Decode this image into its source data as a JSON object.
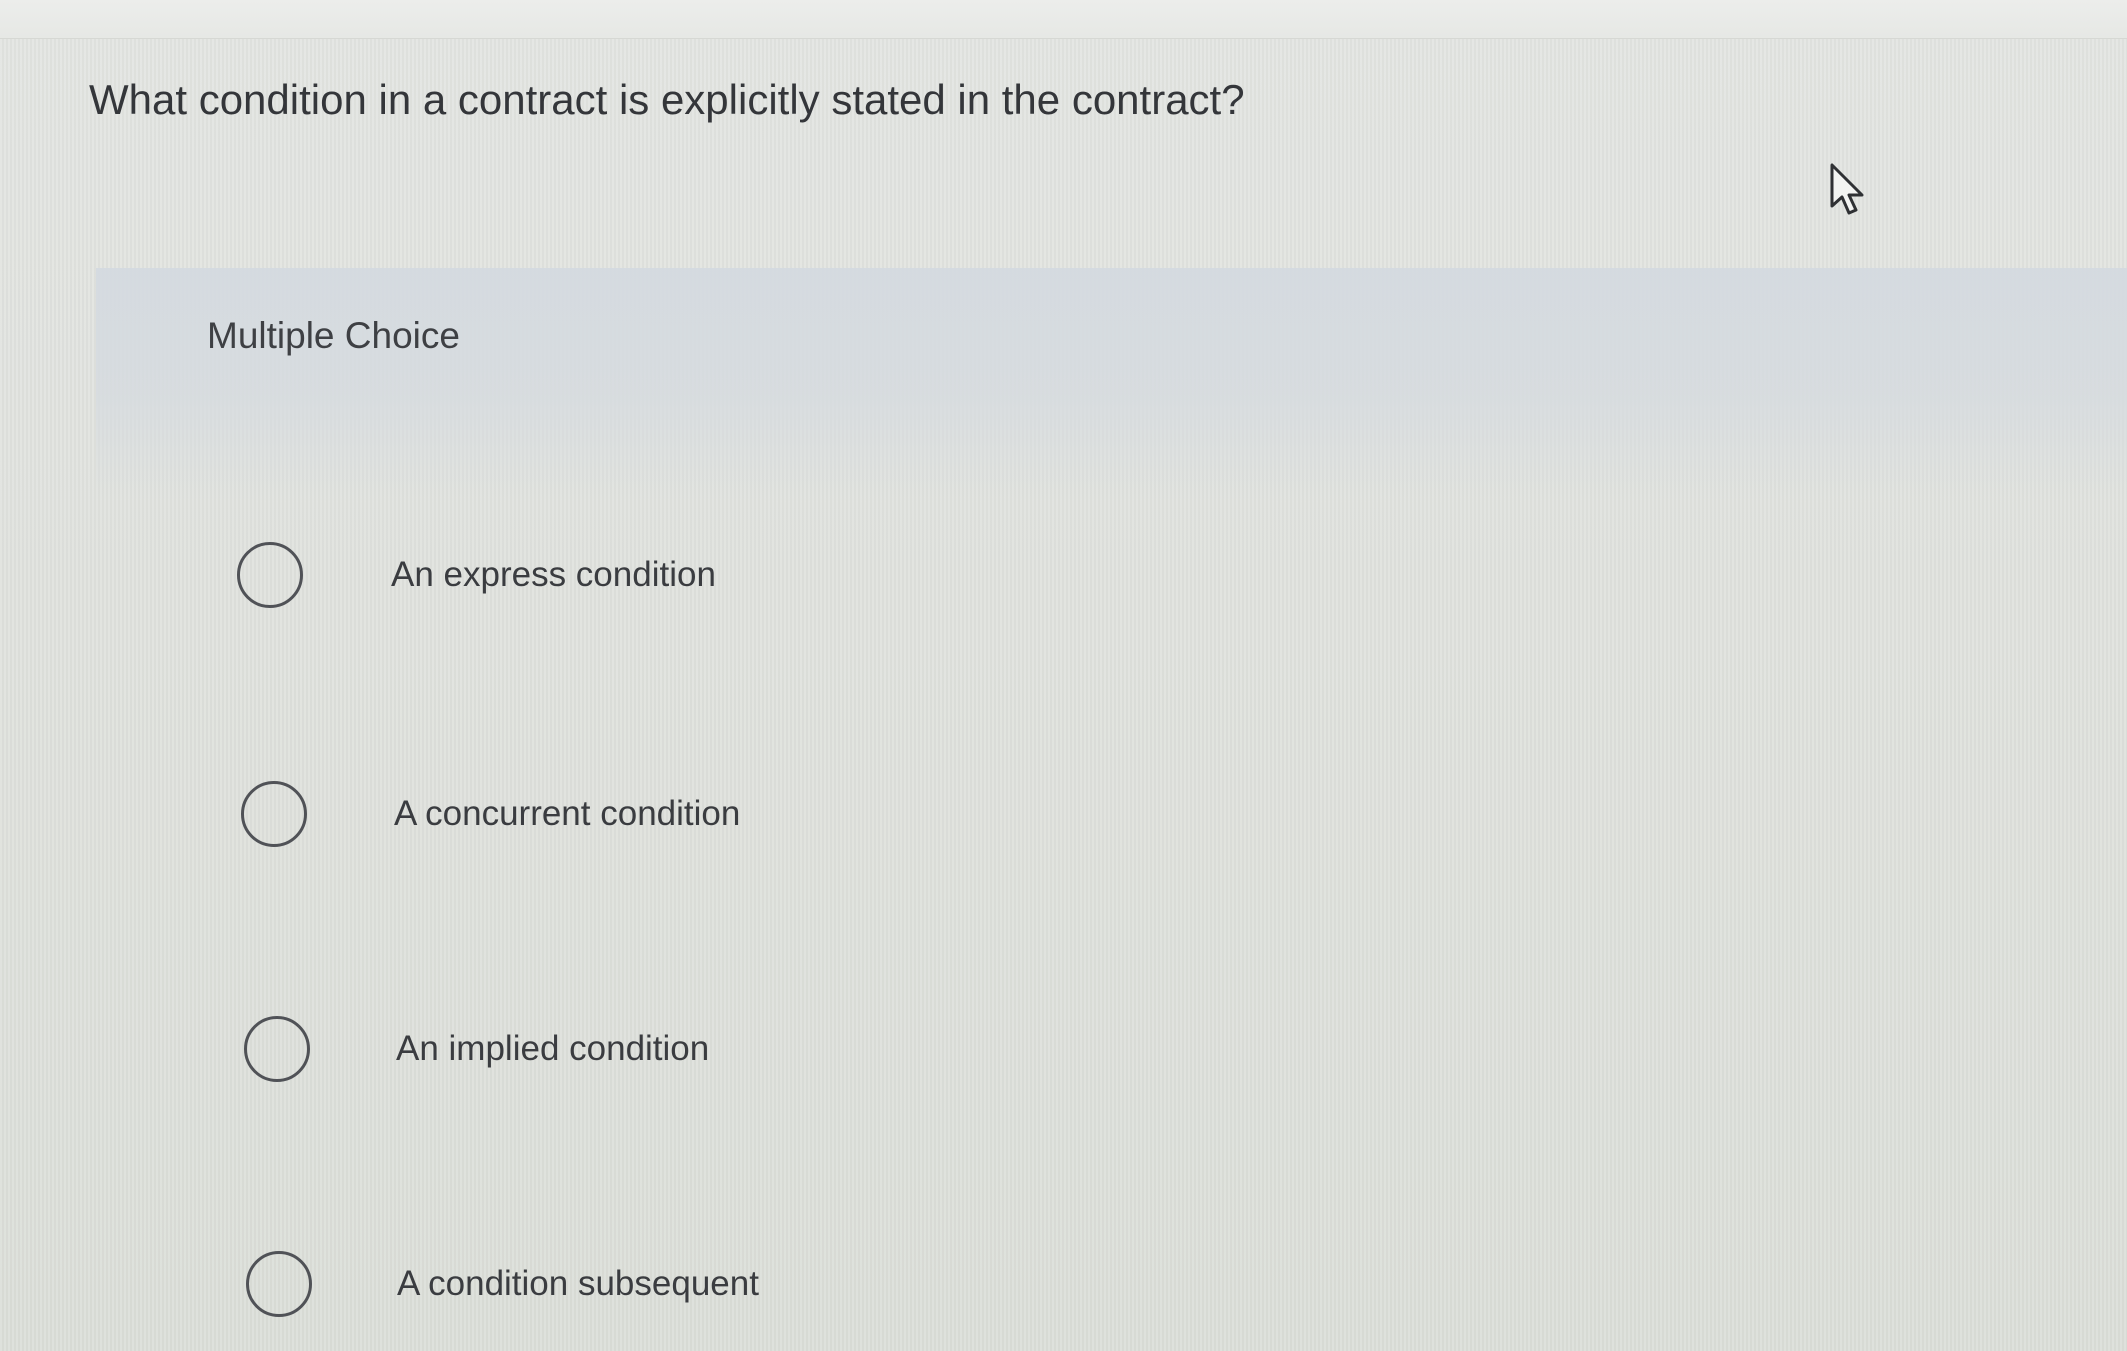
{
  "question": {
    "text": "What condition in a contract is explicitly stated in the contract?"
  },
  "section": {
    "title": "Multiple Choice"
  },
  "choices": [
    {
      "label": "An express condition",
      "selected": false
    },
    {
      "label": "A concurrent condition",
      "selected": false
    },
    {
      "label": "An implied condition",
      "selected": false
    },
    {
      "label": "A condition subsequent",
      "selected": false
    }
  ],
  "colors": {
    "background": "#e0e2de",
    "panel": "#d6dbe0",
    "text": "#3a3c40",
    "radio_border": "#505257"
  },
  "icons": {
    "cursor": "mouse-pointer-icon",
    "radio": "radio-button-icon"
  }
}
